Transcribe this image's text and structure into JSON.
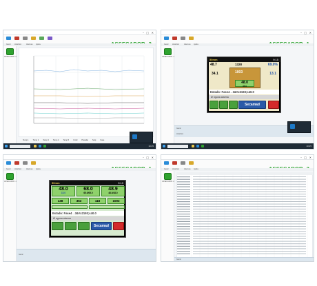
{
  "panels": {
    "top_left": {
      "app_title": "ASSECADOR -2",
      "menu": [
        "Geral",
        "Histórico",
        "Alarmes",
        "Ajuda"
      ],
      "toolbar": [
        "Conectar",
        "Desconectar",
        "Config",
        "Histórico",
        "Relatório",
        "Gráfico"
      ],
      "left_label": "ASSECADOR -2",
      "chart": {
        "footer_legend": [
          "Temp 1",
          "Temp 2",
          "Temp 3",
          "Temp 4",
          "Temp 5",
          "Umid",
          "Pressão",
          "Setp",
          "Fase"
        ]
      },
      "taskbar_clock": "10:25"
    },
    "top_right": {
      "app_title": "ASSECADOR -1",
      "menu": [
        "Geral",
        "Histórico",
        "Alarmes",
        "Ajuda"
      ],
      "left_label": "ASSECADOR -1",
      "hmi": {
        "topbar_value": "50mm",
        "topbar_time": "9:15",
        "temp_main": "48.7",
        "humidity": "69.0%",
        "left_value": "34.1",
        "center_value": "1003",
        "right_value": "13.1",
        "top_setpoint": "1328",
        "green_value": "48.0",
        "green_sub": "35.0",
        "estado_line": "Estado: Fase4→3&#x2193;c40.0",
        "alarm": "Ø  nguna alarma",
        "brand": "Secamad"
      },
      "footer_labels": [
        "Geral",
        "Histórico"
      ],
      "taskbar_clock": "10:25"
    },
    "bottom_left": {
      "app_title": "ASSECADOR -1",
      "menu": [
        "Geral",
        "Histórico",
        "Alarmes",
        "Ajuda"
      ],
      "left_label": "ASSECADOR -1",
      "hmi": {
        "topbar_value": "50mm",
        "topbar_time": "9:13",
        "box1": "48.0",
        "box1_sub": "15.0",
        "box2": "68.0",
        "box2_sub": "65.0/65.0",
        "box3": "48.9",
        "box3_sub": "48.0/48.0",
        "row2": [
          "138",
          "363",
          "118",
          "1003"
        ],
        "estado_line": "Estado: Fase4→3&#x2193;c40.0",
        "alarm": "Ø  nguna alarma",
        "brand": "Secamad"
      },
      "footer_labels": [
        "Geral"
      ]
    },
    "bottom_right": {
      "app_title": "ASSECADOR -2",
      "menu": [
        "Geral",
        "Histórico",
        "Alarmes",
        "Ajuda"
      ],
      "left_label": "ASSECADOR -2",
      "footer_labels": [
        "Geral"
      ]
    }
  }
}
